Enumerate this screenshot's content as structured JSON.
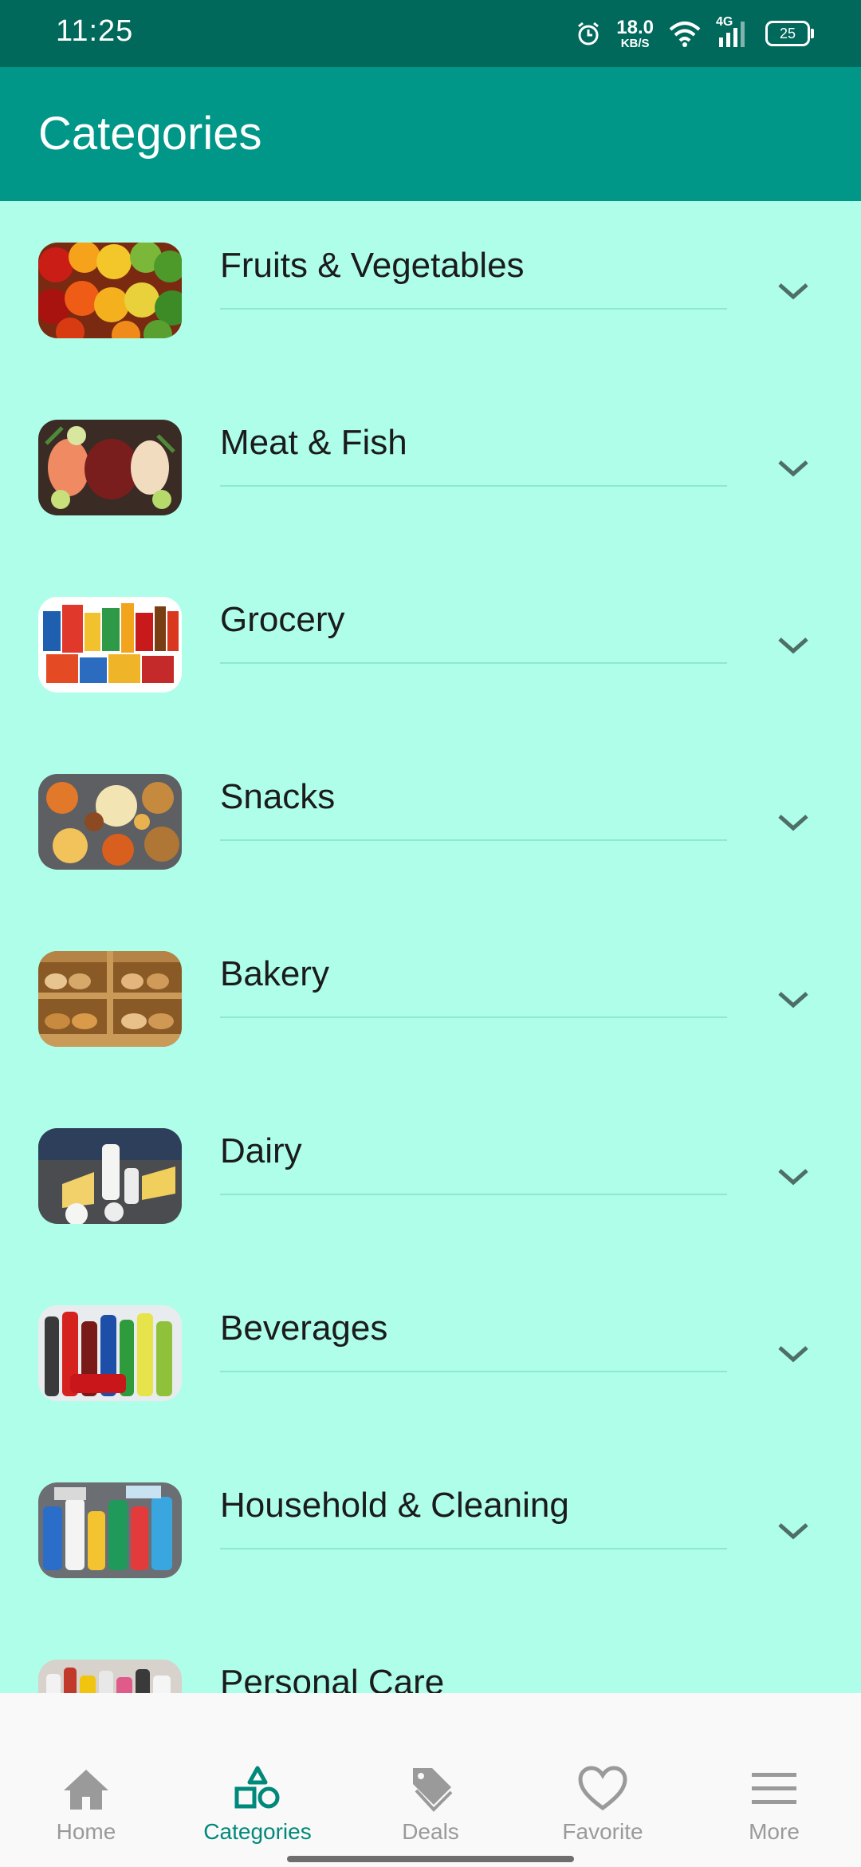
{
  "status_bar": {
    "time": "11:25",
    "net_speed_value": "18.0",
    "net_speed_unit": "KB/S",
    "network_type": "4G",
    "battery": "25"
  },
  "app_bar": {
    "title": "Categories"
  },
  "categories": [
    {
      "label": "Fruits & Vegetables",
      "icon": "fruits-vegetables-thumbnail"
    },
    {
      "label": "Meat & Fish",
      "icon": "meat-fish-thumbnail"
    },
    {
      "label": "Grocery",
      "icon": "grocery-thumbnail"
    },
    {
      "label": "Snacks",
      "icon": "snacks-thumbnail"
    },
    {
      "label": "Bakery",
      "icon": "bakery-thumbnail"
    },
    {
      "label": "Dairy",
      "icon": "dairy-thumbnail"
    },
    {
      "label": "Beverages",
      "icon": "beverages-thumbnail"
    },
    {
      "label": "Household & Cleaning",
      "icon": "household-cleaning-thumbnail"
    },
    {
      "label": "Personal Care",
      "icon": "personal-care-thumbnail"
    }
  ],
  "bottom_nav": {
    "items": [
      {
        "label": "Home",
        "icon": "home-icon",
        "active": false
      },
      {
        "label": "Categories",
        "icon": "categories-icon",
        "active": true
      },
      {
        "label": "Deals",
        "icon": "tag-icon",
        "active": false
      },
      {
        "label": "Favorite",
        "icon": "heart-icon",
        "active": false
      },
      {
        "label": "More",
        "icon": "menu-icon",
        "active": false
      }
    ]
  },
  "colors": {
    "status_bar": "#00695c",
    "app_bar": "#009688",
    "background": "#aefee9",
    "accent": "#00897b",
    "nav_inactive": "#9a9a9a"
  }
}
